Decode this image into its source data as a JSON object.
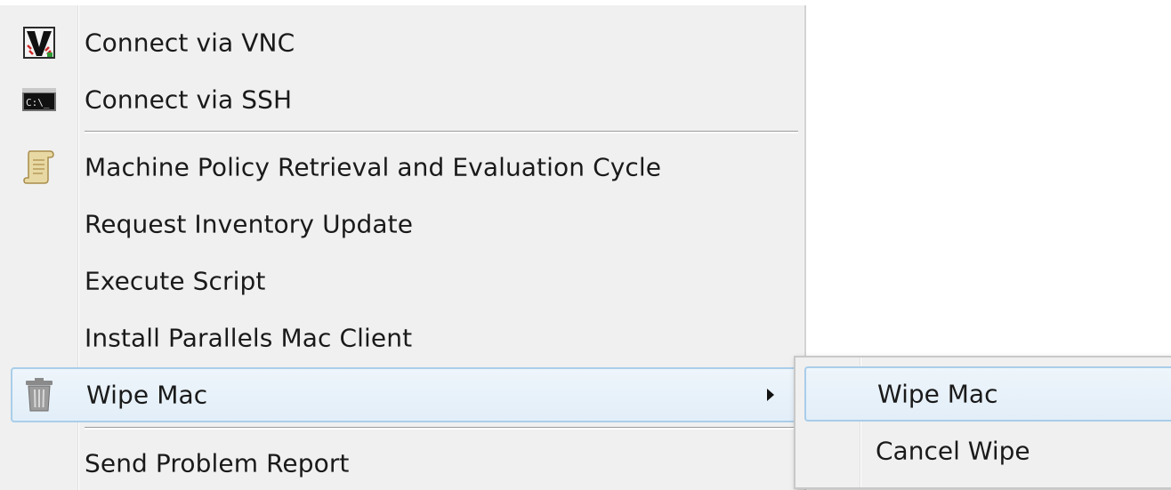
{
  "context_menu": {
    "items": [
      {
        "label": "Connect via VNC",
        "icon": "vnc-icon"
      },
      {
        "label": "Connect via SSH",
        "icon": "terminal-icon"
      },
      {
        "label": "Machine Policy Retrieval and Evaluation Cycle",
        "icon": "scroll-icon"
      },
      {
        "label": "Request Inventory Update",
        "icon": ""
      },
      {
        "label": "Execute Script",
        "icon": ""
      },
      {
        "label": "Install Parallels Mac Client",
        "icon": ""
      },
      {
        "label": "Wipe Mac",
        "icon": "trash-icon",
        "has_submenu": true,
        "highlighted": true
      },
      {
        "label": "Send Problem Report",
        "icon": ""
      }
    ]
  },
  "submenu": {
    "items": [
      {
        "label": "Wipe Mac",
        "highlighted": true
      },
      {
        "label": "Cancel Wipe"
      }
    ]
  },
  "colors": {
    "menu_background": "#f0f0f0",
    "highlight_border": "#a9cde9",
    "highlight_fill": "#e6f0f9"
  }
}
